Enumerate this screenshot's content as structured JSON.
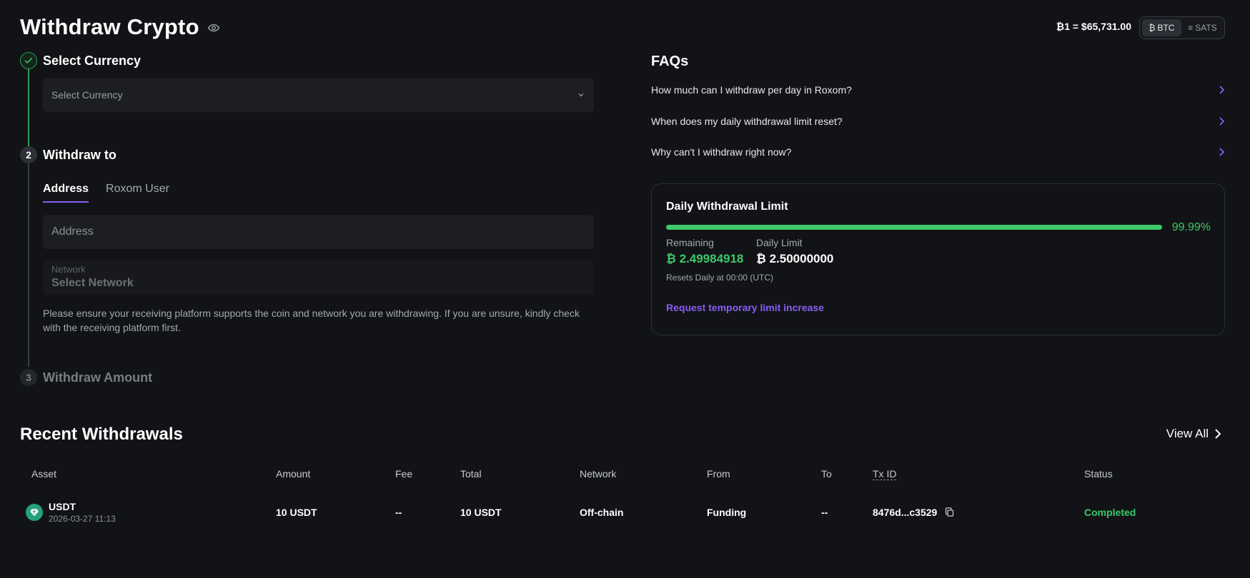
{
  "header": {
    "title": "Withdraw Crypto",
    "rate": "₿1  =  $65,731.00",
    "units": [
      {
        "label": "BTC",
        "icon": "btc-icon",
        "active": true
      },
      {
        "label": "SATS",
        "icon": "sats-icon",
        "active": false
      }
    ]
  },
  "steps": {
    "step1": {
      "title": "Select Currency",
      "select_placeholder": "Select Currency"
    },
    "step2": {
      "number": "2",
      "title": "Withdraw to",
      "tabs": [
        "Address",
        "Roxom User"
      ],
      "address_placeholder": "Address",
      "network_label": "Network",
      "network_placeholder": "Select Network",
      "hint": "Please ensure your receiving platform supports the coin and network you are withdrawing. If you are unsure, kindly check with the receiving platform first."
    },
    "step3": {
      "number": "3",
      "title": "Withdraw Amount"
    }
  },
  "faqs": {
    "title": "FAQs",
    "items": [
      "How much can I withdraw per day in Roxom?",
      "When does my daily withdrawal limit reset?",
      "Why can't I withdraw right now?"
    ]
  },
  "limit": {
    "title": "Daily Withdrawal Limit",
    "progress_percent": 99.99,
    "progress_text": "99.99%",
    "remaining_label": "Remaining",
    "remaining_value": "₿ 2.49984918",
    "daily_label": "Daily Limit",
    "daily_value": "₿ 2.50000000",
    "resets": "Resets Daily at 00:00 (UTC)",
    "request_link": "Request temporary limit increase"
  },
  "recent": {
    "title": "Recent Withdrawals",
    "view_all": "View All",
    "columns": [
      "Asset",
      "Amount",
      "Fee",
      "Total",
      "Network",
      "From",
      "To",
      "Tx ID",
      "Status"
    ],
    "rows": [
      {
        "asset": "USDT",
        "date": "2026-03-27 11:13",
        "amount": "10 USDT",
        "fee": "--",
        "total": "10 USDT",
        "network": "Off-chain",
        "from": "Funding",
        "to": "--",
        "txid": "8476d...c3529",
        "status": "Completed"
      }
    ]
  },
  "colors": {
    "accent": "#8b5cf6",
    "success": "#3ec96a",
    "background": "#111316",
    "tether": "#26a17b"
  }
}
